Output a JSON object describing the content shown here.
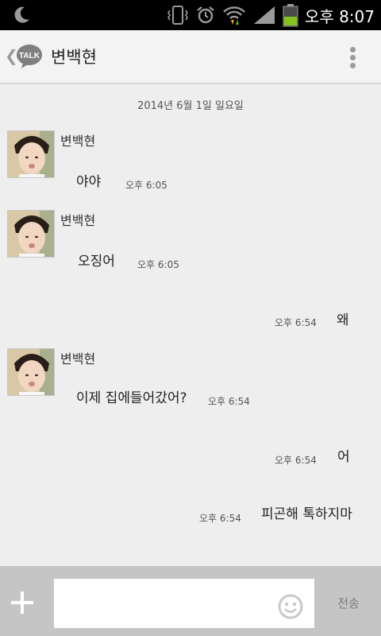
{
  "status_bar": {
    "time": "오후 8:07",
    "icons": [
      "moon-icon",
      "vibrate-icon",
      "alarm-icon",
      "wifi-icon",
      "signal-icon",
      "battery-icon"
    ]
  },
  "app_bar": {
    "back_icon": "chevron-left-icon",
    "logo_text": "TALK",
    "title": "변백현",
    "menu_icon": "overflow-menu-icon"
  },
  "chat": {
    "date": "2014년 6월 1일 일요일",
    "messages": [
      {
        "sender": "변백현",
        "text": "야야",
        "time": "오후 6:05",
        "incoming": true
      },
      {
        "sender": "변백현",
        "text": "오징어",
        "time": "오후 6:05",
        "incoming": true
      },
      {
        "sender": "",
        "text": "왜",
        "time": "오후 6:54",
        "incoming": false
      },
      {
        "sender": "변백현",
        "text": "이제 집에들어갔어?",
        "time": "오후 6:54",
        "incoming": true
      },
      {
        "sender": "",
        "text": "어",
        "time": "오후 6:54",
        "incoming": false
      },
      {
        "sender": "",
        "text": "피곤해 톡하지마",
        "time": "오후 6:54",
        "incoming": false
      }
    ]
  },
  "input_bar": {
    "plus_icon": "plus-icon",
    "message_value": "",
    "emoji_icon": "smiley-icon",
    "send_label": "전송"
  },
  "colors": {
    "background": "#eeeeee",
    "status_bar": "#000000",
    "input_bar": "#c5c5c5",
    "battery_fill": "#86c21f"
  }
}
